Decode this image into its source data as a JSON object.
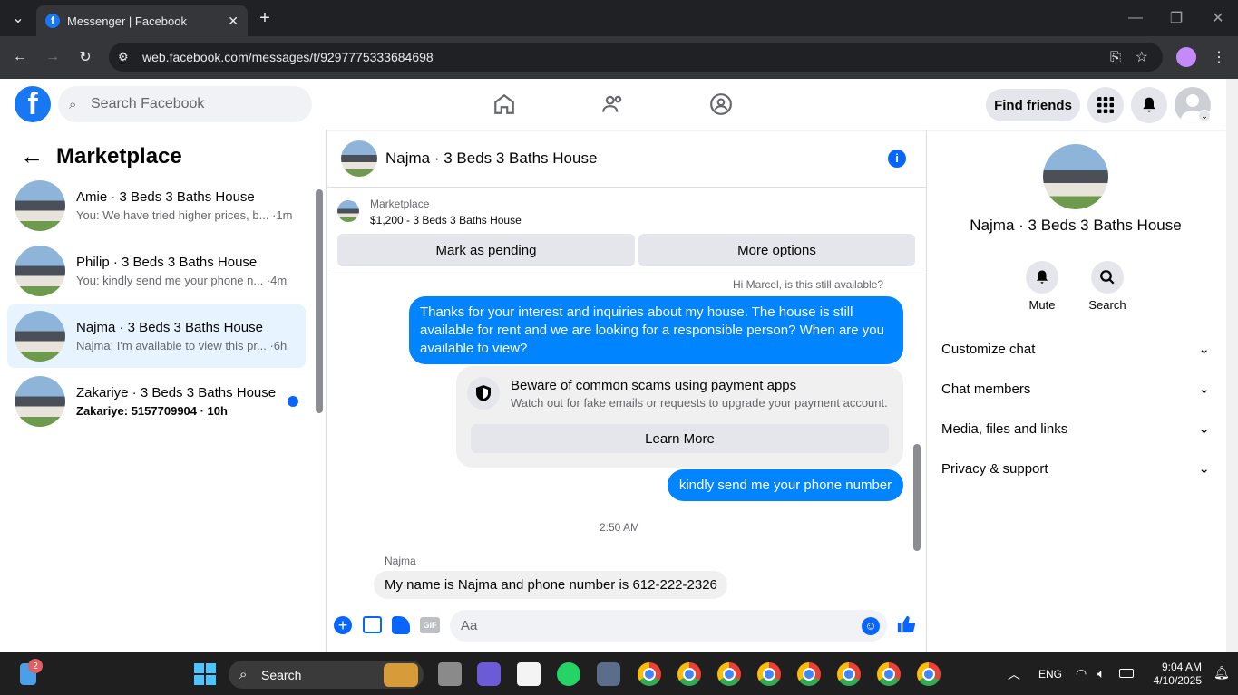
{
  "browser": {
    "tab_title": "Messenger | Facebook",
    "url": "web.facebook.com/messages/t/9297775333684698"
  },
  "fb": {
    "search_placeholder": "Search Facebook",
    "find_friends": "Find friends"
  },
  "left": {
    "title": "Marketplace",
    "conversations": [
      {
        "name": "Amie · 3 Beds 3 Baths House",
        "preview": "You: We have tried higher prices, b... ·1m"
      },
      {
        "name": "Philip · 3 Beds 3 Baths House",
        "preview": "You: kindly send me your phone n... ·4m"
      },
      {
        "name": "Najma · 3 Beds 3 Baths House",
        "preview": "Najma: I'm available to view this pr... ·6h"
      },
      {
        "name": "Zakariye · 3 Beds 3 Baths House",
        "preview": "Zakariye: 5157709904 · 10h"
      }
    ]
  },
  "chat": {
    "title": "Najma · 3 Beds 3 Baths House",
    "listing": {
      "label": "Marketplace",
      "detail": "$1,200 - 3 Beds 3 Baths House"
    },
    "mark_pending": "Mark as pending",
    "more_options": "More options",
    "reply_preview": "Hi Marcel, is this still available?",
    "msg1": "Thanks for your interest and inquiries about my house. The house is still available for rent and we are looking for a responsible person? When are you available to view?",
    "scam_title": "Beware of common scams using payment apps",
    "scam_text": "Watch out for fake emails or requests to upgrade your payment account.",
    "learn_more": "Learn More",
    "msg2": "kindly send me your phone number",
    "timestamp": "2:50 AM",
    "sender": "Najma",
    "msg3": "My name is Najma and phone number is 612-222-2326",
    "composer_placeholder": "Aa"
  },
  "right": {
    "name": "Najma · 3 Beds 3 Baths House",
    "mute": "Mute",
    "search": "Search",
    "sections": [
      "Customize chat",
      "Chat members",
      "Media, files and links",
      "Privacy & support"
    ]
  },
  "taskbar": {
    "search": "Search",
    "lang": "ENG",
    "time": "9:04 AM",
    "date": "4/10/2025",
    "badge": "2"
  }
}
